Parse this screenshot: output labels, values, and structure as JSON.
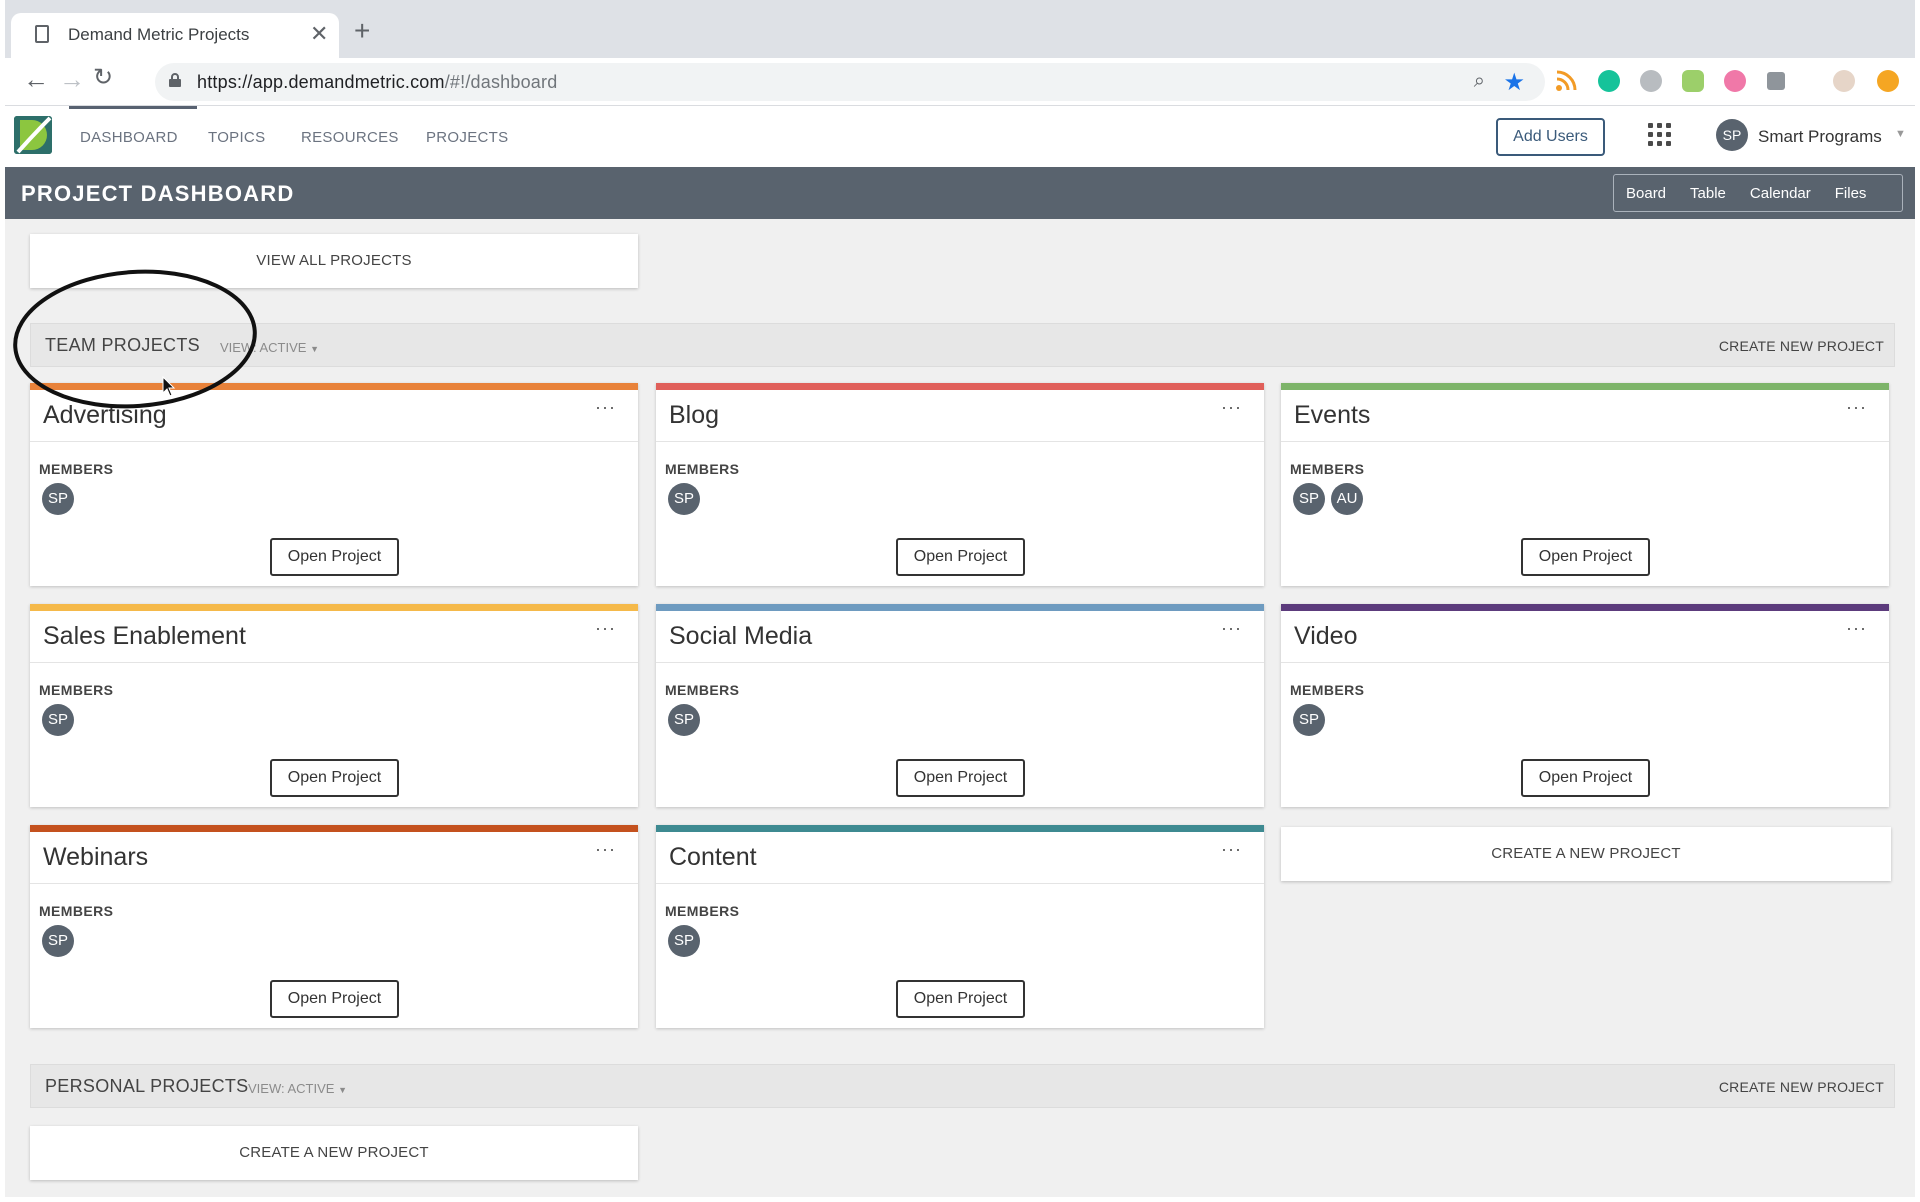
{
  "browser": {
    "tab_title": "Demand Metric Projects",
    "tab_close": "✕",
    "new_tab": "+",
    "url_main": "https://app.demandmetric.com",
    "url_path": "/#!/dashboard"
  },
  "nav": {
    "links": [
      "DASHBOARD",
      "TOPICS",
      "RESOURCES",
      "PROJECTS"
    ],
    "add_users": "Add Users",
    "user_initials": "SP",
    "user_name": "Smart Programs"
  },
  "header": {
    "title": "PROJECT DASHBOARD",
    "views": [
      "Board",
      "Table",
      "Calendar",
      "Files"
    ]
  },
  "view_all": "VIEW ALL PROJECTS",
  "team": {
    "title": "TEAM PROJECTS",
    "view": "VIEW: ACTIVE",
    "create_link": "CREATE NEW PROJECT",
    "members_label": "MEMBERS",
    "open_label": "Open Project",
    "more": "···",
    "projects": [
      {
        "name": "Advertising",
        "color": "#e8823a",
        "members": [
          "SP"
        ]
      },
      {
        "name": "Blog",
        "color": "#e05f5a",
        "members": [
          "SP"
        ]
      },
      {
        "name": "Events",
        "color": "#7db469",
        "members": [
          "SP",
          "AU"
        ]
      },
      {
        "name": "Sales Enablement",
        "color": "#f5b94a",
        "members": [
          "SP"
        ]
      },
      {
        "name": "Social Media",
        "color": "#6e9bc0",
        "members": [
          "SP"
        ]
      },
      {
        "name": "Video",
        "color": "#5c3b7c",
        "members": [
          "SP"
        ]
      },
      {
        "name": "Webinars",
        "color": "#c4511e",
        "members": [
          "SP"
        ]
      },
      {
        "name": "Content",
        "color": "#3e8a91",
        "members": [
          "SP"
        ]
      }
    ],
    "create_card": "CREATE A NEW PROJECT"
  },
  "personal": {
    "title": "PERSONAL PROJECTS",
    "view": "VIEW: ACTIVE",
    "create_link": "CREATE NEW PROJECT",
    "create_card": "CREATE A NEW PROJECT"
  },
  "colors": {
    "header_bg": "#59636e",
    "content_bg": "#f0f0f0",
    "add_users_border": "#3a5a7a"
  }
}
